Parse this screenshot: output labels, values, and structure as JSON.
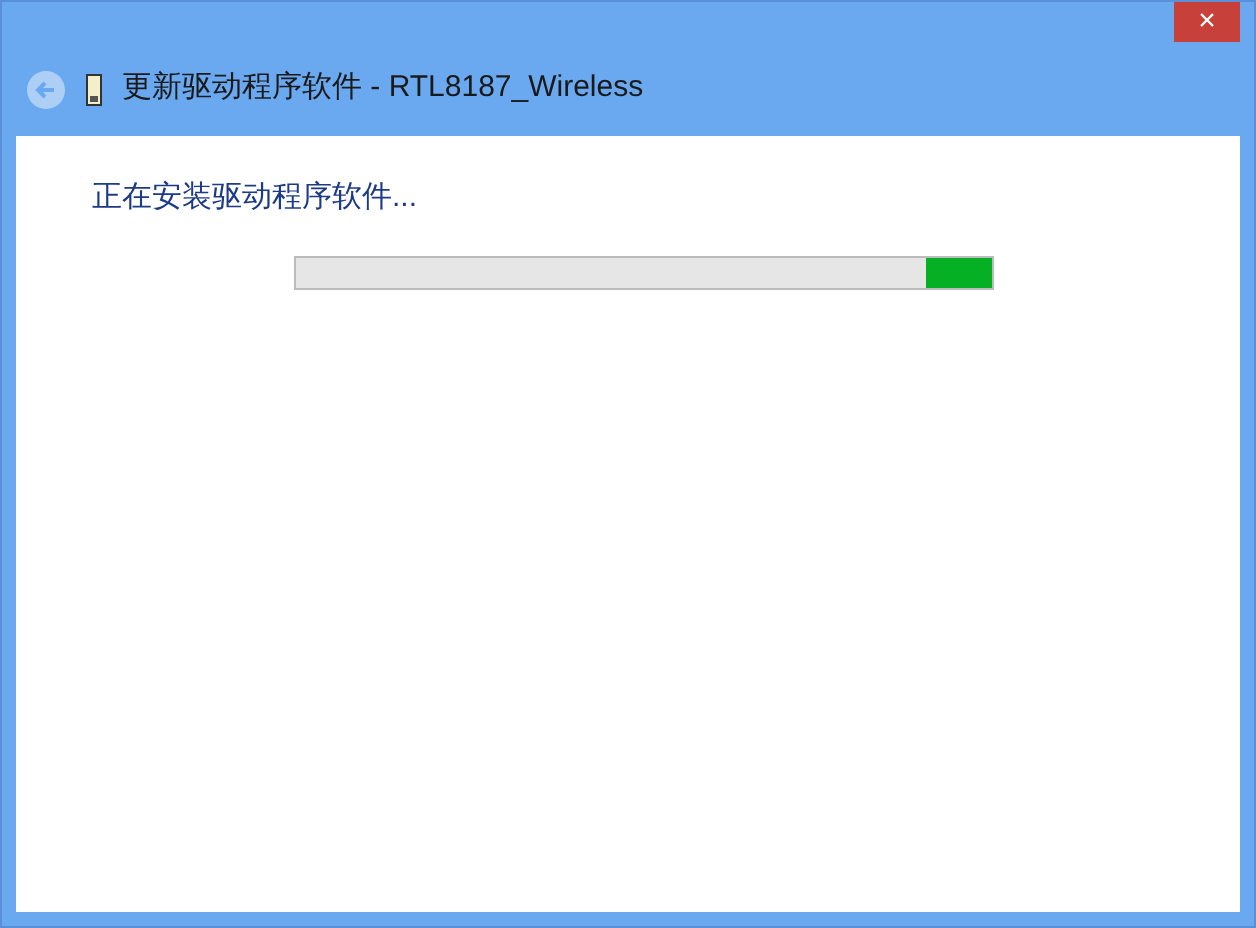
{
  "window": {
    "close_label": "×",
    "title": "更新驱动程序软件 - RTL8187_Wireless",
    "back_button": {
      "disabled": true
    }
  },
  "content": {
    "status": "正在安装驱动程序软件...",
    "progress": {
      "marquee": true
    }
  }
}
